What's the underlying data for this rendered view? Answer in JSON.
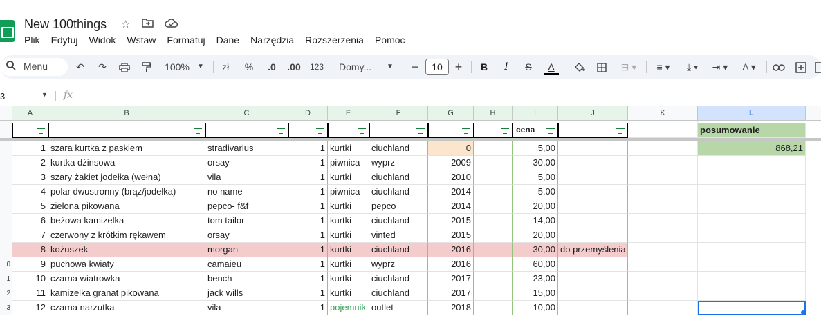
{
  "doc": {
    "title": "New 100things",
    "star_icon": "star-icon",
    "move_icon": "folder-move-icon",
    "cloud_icon": "cloud-status-icon"
  },
  "menu": [
    "Plik",
    "Edytuj",
    "Widok",
    "Wstaw",
    "Formatuj",
    "Dane",
    "Narzędzia",
    "Rozszerzenia",
    "Pomoc"
  ],
  "toolbar": {
    "search_label": "Menu",
    "zoom": "100%",
    "currency": "zł",
    "percent": "%",
    "dec_decrease": ".0",
    "dec_increase": ".00",
    "number_format": "123",
    "font": "Domy...",
    "font_size": "10",
    "minus": "−",
    "plus": "+",
    "bold": "B",
    "italic": "I",
    "text_color": "A"
  },
  "formula": {
    "cell_ref": "3",
    "fx": "fx"
  },
  "columns": [
    "A",
    "B",
    "C",
    "D",
    "E",
    "F",
    "G",
    "H",
    "I",
    "J",
    "K",
    "L"
  ],
  "filter_row": {
    "i_label": "cena",
    "l_label": "posumowanie"
  },
  "summary_value": "868,21",
  "rows": [
    {
      "rowhdr": "",
      "a": "1",
      "b": "szara kurtka z paskiem",
      "c": "stradivarius",
      "d": "1",
      "e": "kurtki",
      "f": "ciuchland",
      "g": "0",
      "i": "5,00",
      "j": ""
    },
    {
      "rowhdr": "",
      "a": "2",
      "b": "kurtka dżinsowa",
      "c": "orsay",
      "d": "1",
      "e": "piwnica",
      "f": "wyprz",
      "g": "2009",
      "i": "30,00",
      "j": ""
    },
    {
      "rowhdr": "",
      "a": "3",
      "b": "szary żakiet jodełka (wełna)",
      "c": "vila",
      "d": "1",
      "e": "kurtki",
      "f": "ciuchland",
      "g": "2010",
      "i": "5,00",
      "j": ""
    },
    {
      "rowhdr": "",
      "a": "4",
      "b": "polar dwustronny (brąz/jodełka)",
      "c": "no name",
      "d": "1",
      "e": "piwnica",
      "f": "ciuchland",
      "g": "2014",
      "i": "5,00",
      "j": ""
    },
    {
      "rowhdr": "",
      "a": "5",
      "b": "zielona pikowana",
      "c": "pepco- f&f",
      "d": "1",
      "e": "kurtki",
      "f": "pepco",
      "g": "2014",
      "i": "20,00",
      "j": ""
    },
    {
      "rowhdr": "",
      "a": "6",
      "b": "beżowa kamizelka",
      "c": "tom tailor",
      "d": "1",
      "e": "kurtki",
      "f": "ciuchland",
      "g": "2015",
      "i": "14,00",
      "j": ""
    },
    {
      "rowhdr": "",
      "a": "7",
      "b": "czerwony z krótkim rękawem",
      "c": "orsay",
      "d": "1",
      "e": "kurtki",
      "f": "vinted",
      "g": "2015",
      "i": "20,00",
      "j": ""
    },
    {
      "rowhdr": "",
      "a": "8",
      "b": "kożuszek",
      "c": "morgan",
      "d": "1",
      "e": "kurtki",
      "f": "ciuchland",
      "g": "2016",
      "i": "30,00",
      "j": "do przemyślenia"
    },
    {
      "rowhdr": "0",
      "a": "9",
      "b": "puchowa kwiaty",
      "c": "camaieu",
      "d": "1",
      "e": "kurtki",
      "f": "wyprz",
      "g": "2016",
      "i": "60,00",
      "j": ""
    },
    {
      "rowhdr": "1",
      "a": "10",
      "b": "czarna wiatrowka",
      "c": "bench",
      "d": "1",
      "e": "kurtki",
      "f": "ciuchland",
      "g": "2017",
      "i": "23,00",
      "j": ""
    },
    {
      "rowhdr": "2",
      "a": "11",
      "b": "kamizelka granat pikowana",
      "c": "jack wills",
      "d": "1",
      "e": "kurtki",
      "f": "ciuchland",
      "g": "2017",
      "i": "15,00",
      "j": ""
    },
    {
      "rowhdr": "3",
      "a": "12",
      "b": "czarna narzutka",
      "c": "vila",
      "d": "1",
      "e": "pojemnik",
      "f": "outlet",
      "g": "2018",
      "i": "10,00",
      "j": ""
    }
  ],
  "colors": {
    "header_green": "#b7d7a8",
    "highlight_pink": "#f4cccc",
    "highlight_orange": "#fce5cd",
    "selection_blue": "#1a73e8",
    "pojemnik_green": "#38a35a"
  }
}
